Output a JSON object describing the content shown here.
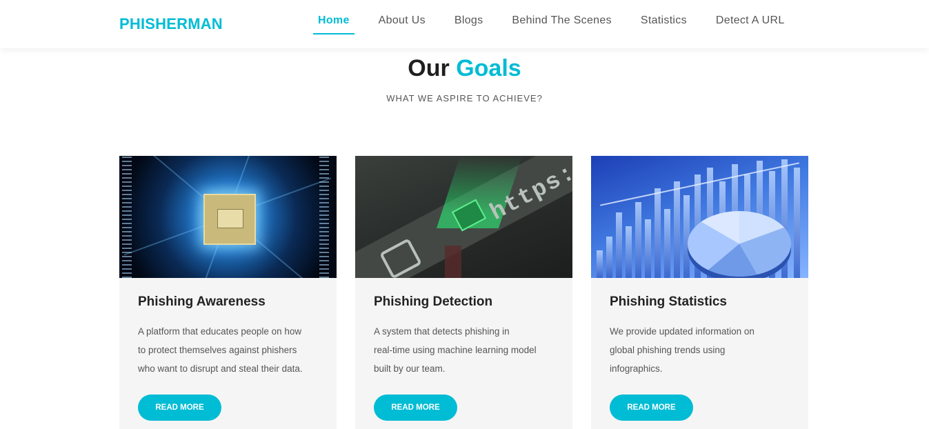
{
  "brand": {
    "name": "PHISHERMAN",
    "color": "#00bcd4"
  },
  "nav": {
    "items": [
      {
        "label": "Home",
        "active": true
      },
      {
        "label": "About Us"
      },
      {
        "label": "Blogs"
      },
      {
        "label": "Behind The Scenes"
      },
      {
        "label": "Statistics"
      },
      {
        "label": "Detect A URL"
      }
    ]
  },
  "section": {
    "title_plain": "Our",
    "title_accent": "Goals",
    "subtitle": "WHAT WE ASPIRE TO ACHIEVE?"
  },
  "cards": [
    {
      "image": "circuit-board-with-fishhook-image",
      "title": "Phishing Awareness",
      "lines": [
        "A platform that educates people on how",
        "to protect themselves against phishers",
        "who want to disrupt and steal their data."
      ],
      "button": "READ MORE"
    },
    {
      "image": "https-address-bar-lock-image",
      "title": "Phishing Detection",
      "lines": [
        "A system that detects phishing in",
        "real-time using machine learning model",
        "built by our team."
      ],
      "button": "READ MORE"
    },
    {
      "image": "charts-and-pie-graph-image",
      "title": "Phishing Statistics",
      "lines": [
        "We provide updated information on",
        "global phishing trends using",
        "infographics."
      ],
      "button": "READ MORE"
    }
  ]
}
